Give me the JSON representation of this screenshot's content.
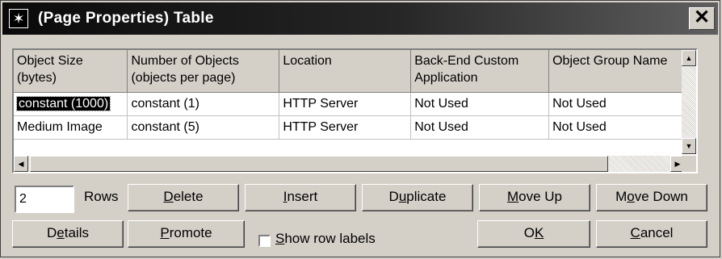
{
  "window": {
    "title": "(Page Properties) Table",
    "close_glyph": "✕",
    "icon_glyph": "✶"
  },
  "table": {
    "columns": [
      {
        "line1": "Object Size",
        "line2": "(bytes)"
      },
      {
        "line1": "Number of Objects",
        "line2": "(objects per page)"
      },
      {
        "line1": "Location",
        "line2": ""
      },
      {
        "line1": "Back-End Custom",
        "line2": "Application"
      },
      {
        "line1": "Object Group Name",
        "line2": ""
      }
    ],
    "rows": [
      [
        "constant (1000)",
        "constant (1)",
        "HTTP Server",
        "Not Used",
        "Not Used"
      ],
      [
        "Medium Image",
        "constant (5)",
        "HTTP Server",
        "Not Used",
        "Not Used"
      ]
    ],
    "selected_cell": "constant (1000)"
  },
  "rows_control": {
    "value": "2",
    "label": "Rows"
  },
  "buttons": {
    "delete": {
      "pre": "",
      "u": "D",
      "post": "elete"
    },
    "insert": {
      "pre": "",
      "u": "I",
      "post": "nsert"
    },
    "duplicate": {
      "pre": "D",
      "u": "u",
      "post": "plicate"
    },
    "move_up": {
      "pre": "",
      "u": "M",
      "post": "ove Up"
    },
    "move_down": {
      "pre": "M",
      "u": "o",
      "post": "ve Down"
    },
    "details": {
      "pre": "D",
      "u": "e",
      "post": "tails"
    },
    "promote": {
      "pre": "",
      "u": "P",
      "post": "romote"
    },
    "ok": {
      "pre": "O",
      "u": "K",
      "post": ""
    },
    "cancel": {
      "pre": "",
      "u": "C",
      "post": "ancel"
    }
  },
  "show_row_labels": {
    "pre": "",
    "u": "S",
    "post": "how row labels",
    "checked": false
  }
}
